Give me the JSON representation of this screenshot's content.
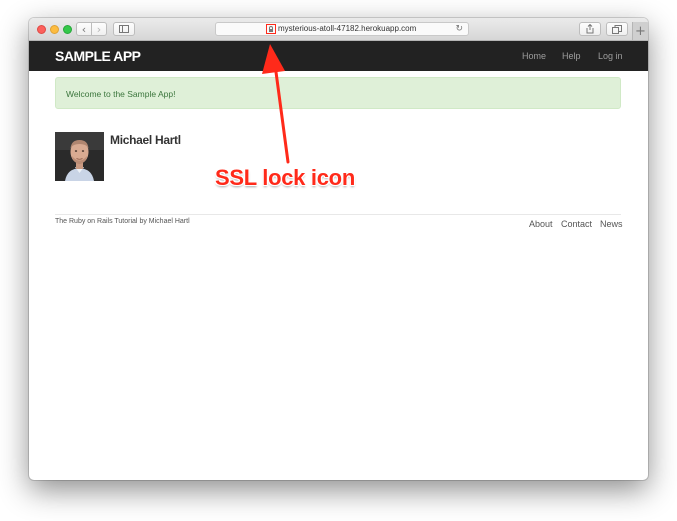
{
  "browser": {
    "url": "mysterious-atoll-47182.herokuapp.com",
    "icons": {
      "back": "chevron-left-icon",
      "forward": "chevron-right-icon",
      "sidebar": "sidebar-icon",
      "lock": "lock-icon",
      "reload": "reload-icon",
      "share": "share-icon",
      "tabs": "tabs-icon",
      "new_tab": "plus-icon"
    }
  },
  "app": {
    "brand": "sample app",
    "nav": {
      "home": "Home",
      "help": "Help",
      "login": "Log in"
    },
    "flash": "Welcome to the Sample App!",
    "user": {
      "name": "Michael Hartl"
    },
    "footer": {
      "tutorial_link": "The Ruby on Rails Tutorial",
      "by_text": "by",
      "author_link": "Michael Hartl",
      "about": "About",
      "contact": "Contact",
      "news": "News"
    }
  },
  "annotation": {
    "label": "SSL lock icon",
    "color": "#ff2a1a"
  },
  "colors": {
    "navbar": "#222222",
    "flash_bg": "#dff0d8",
    "flash_text": "#3c763d"
  }
}
